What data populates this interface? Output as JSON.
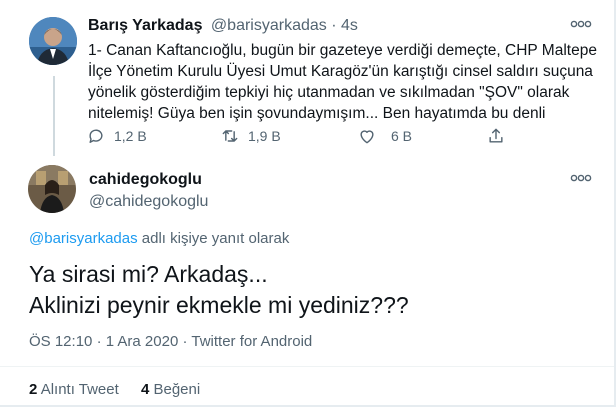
{
  "tweet1": {
    "display_name": "Barış Yarkadaş",
    "handle": "@barisyarkadas",
    "separator": "·",
    "time": "4s",
    "lines": [
      "1- Canan Kaftancıoğlu, bugün bir gazeteye verdiği demeçte, CHP Maltepe",
      "İlçe Yönetim Kurulu Üyesi Umut Karagöz'ün karıştığı cinsel saldırı suçuna",
      "yönelik gösterdiğim tepkiyi hiç utanmadan ve sıkılmadan \"ŞOV\" olarak",
      "nitelemiş! Güya ben işin şovundaymışım... Ben hayatımda bu denli"
    ],
    "replies": "1,2 B",
    "retweets": "1,9 B",
    "likes": "6 B",
    "icons": [
      "reply-icon",
      "retweet-icon",
      "like-icon",
      "share-icon"
    ]
  },
  "tweet2": {
    "display_name": "cahidegokoglu",
    "handle": "@cahidegokoglu",
    "reply_to_handle": "@barisyarkadas",
    "reply_to_suffix": " adlı kişiye yanıt olarak",
    "text_line1": "Ya sirasi mi? Arkadaş...",
    "text_line2": "Aklinizi peynir ekmekle mi yediniz???",
    "time": "ÖS 12:10",
    "sep1": "·",
    "date": "1 Ara 2020",
    "sep2": "·",
    "source": "Twitter for Android",
    "quote_count": "2",
    "quote_label": "Alıntı Tweet",
    "like_count": "4",
    "like_label": "Beğeni"
  },
  "colors": {
    "text": "#0f1419",
    "secondary": "#536471",
    "link": "#1d9bf0",
    "divider": "#eff3f4"
  }
}
